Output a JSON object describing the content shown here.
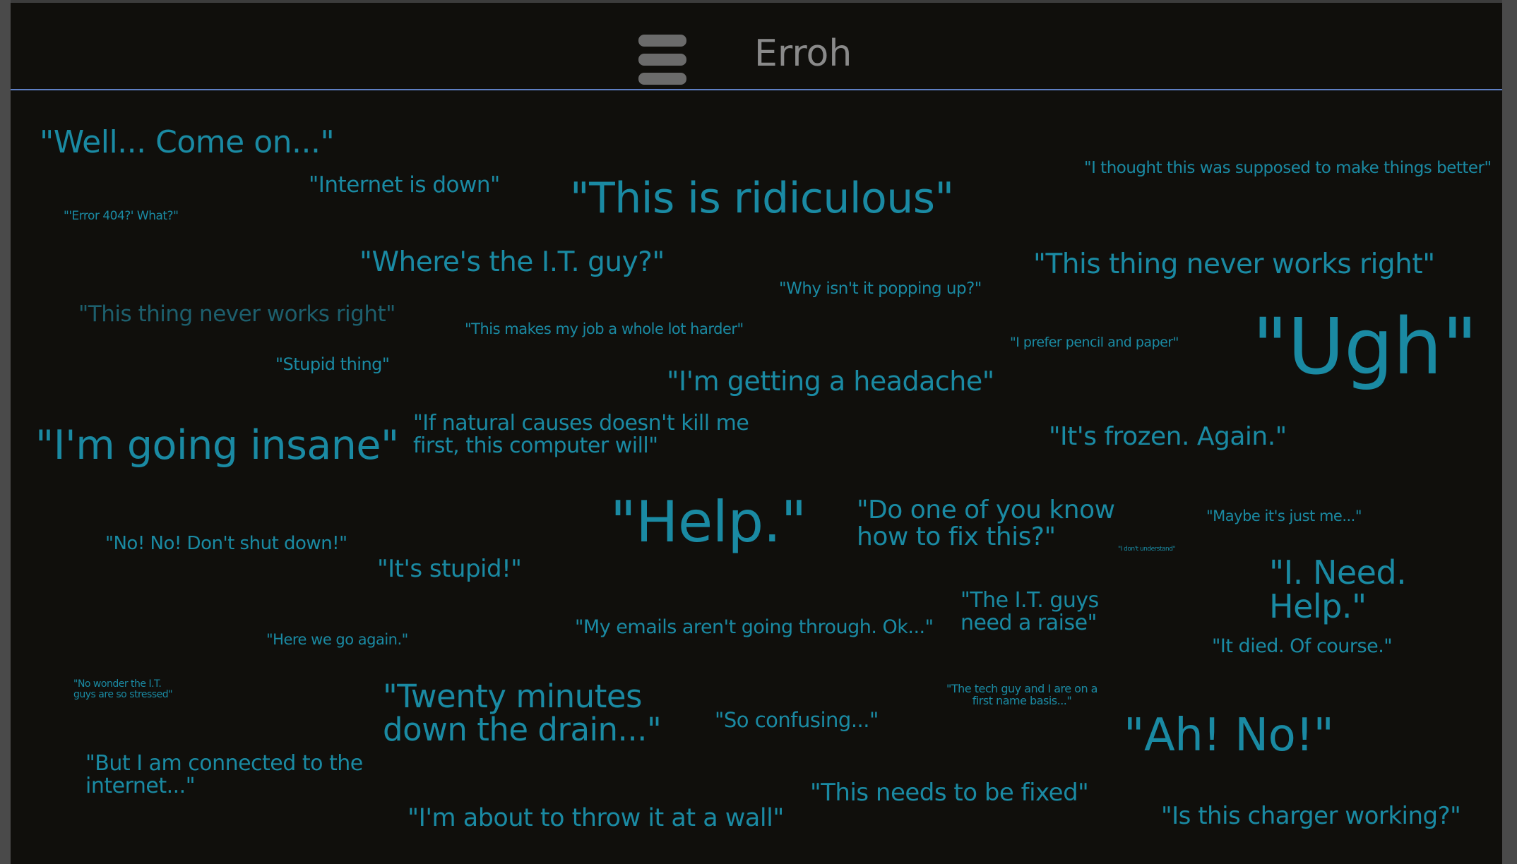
{
  "header": {
    "title": "Erroh",
    "menu_icon": "hamburger-menu-icon"
  },
  "colors": {
    "background": "#100f0c",
    "quote_text": "#1a8aa3",
    "quote_faint": "#1d5f6d",
    "header_line": "#5e7fc4",
    "title_text": "#8a8a8a",
    "menu_icon": "#6b6b6b"
  },
  "quotes": [
    "\"Well... Come on...\"",
    "\"Internet is down\"",
    "\"This is ridiculous\"",
    "\"I thought this was supposed to make things better\"",
    "\"'Error 404?' What?\"",
    "\"Where's the I.T. guy?\"",
    "\"This thing never works right\"",
    "\"Why isn't it popping up?\"",
    "\"This thing never works right\"",
    "\"This makes my job a whole lot harder\"",
    "\"Ugh\"",
    "\"I prefer pencil and paper\"",
    "\"Stupid thing\"",
    "\"I'm getting a headache\"",
    "\"I'm going insane\"",
    "\"If natural causes doesn't kill me\nfirst, this computer will\"",
    "\"It's frozen. Again.\"",
    "\"Help.\"",
    "\"Do one of you know\nhow to fix this?\"",
    "\"Maybe it's just me...\"",
    "\"I don't understand\"",
    "\"No! No! Don't shut down!\"",
    "\"It's stupid!\"",
    "\"I. Need. Help.\"",
    "\"The I.T. guys\nneed a raise\"",
    "\"My emails aren't going through. Ok...\"",
    "\"Here we go again.\"",
    "\"It died. Of course.\"",
    "\"No wonder the I.T.\nguys are so stressed\"",
    "\"Twenty minutes\ndown the drain...\"",
    "\"The tech guy and I are on a\nfirst name basis...\"",
    "\"So confusing...\"",
    "\"Ah! No!\"",
    "\"But I am connected to the\ninternet...\"",
    "\"This needs to be fixed\"",
    "\"I'm about to throw it at a wall\"",
    "\"Is this charger working?\""
  ]
}
